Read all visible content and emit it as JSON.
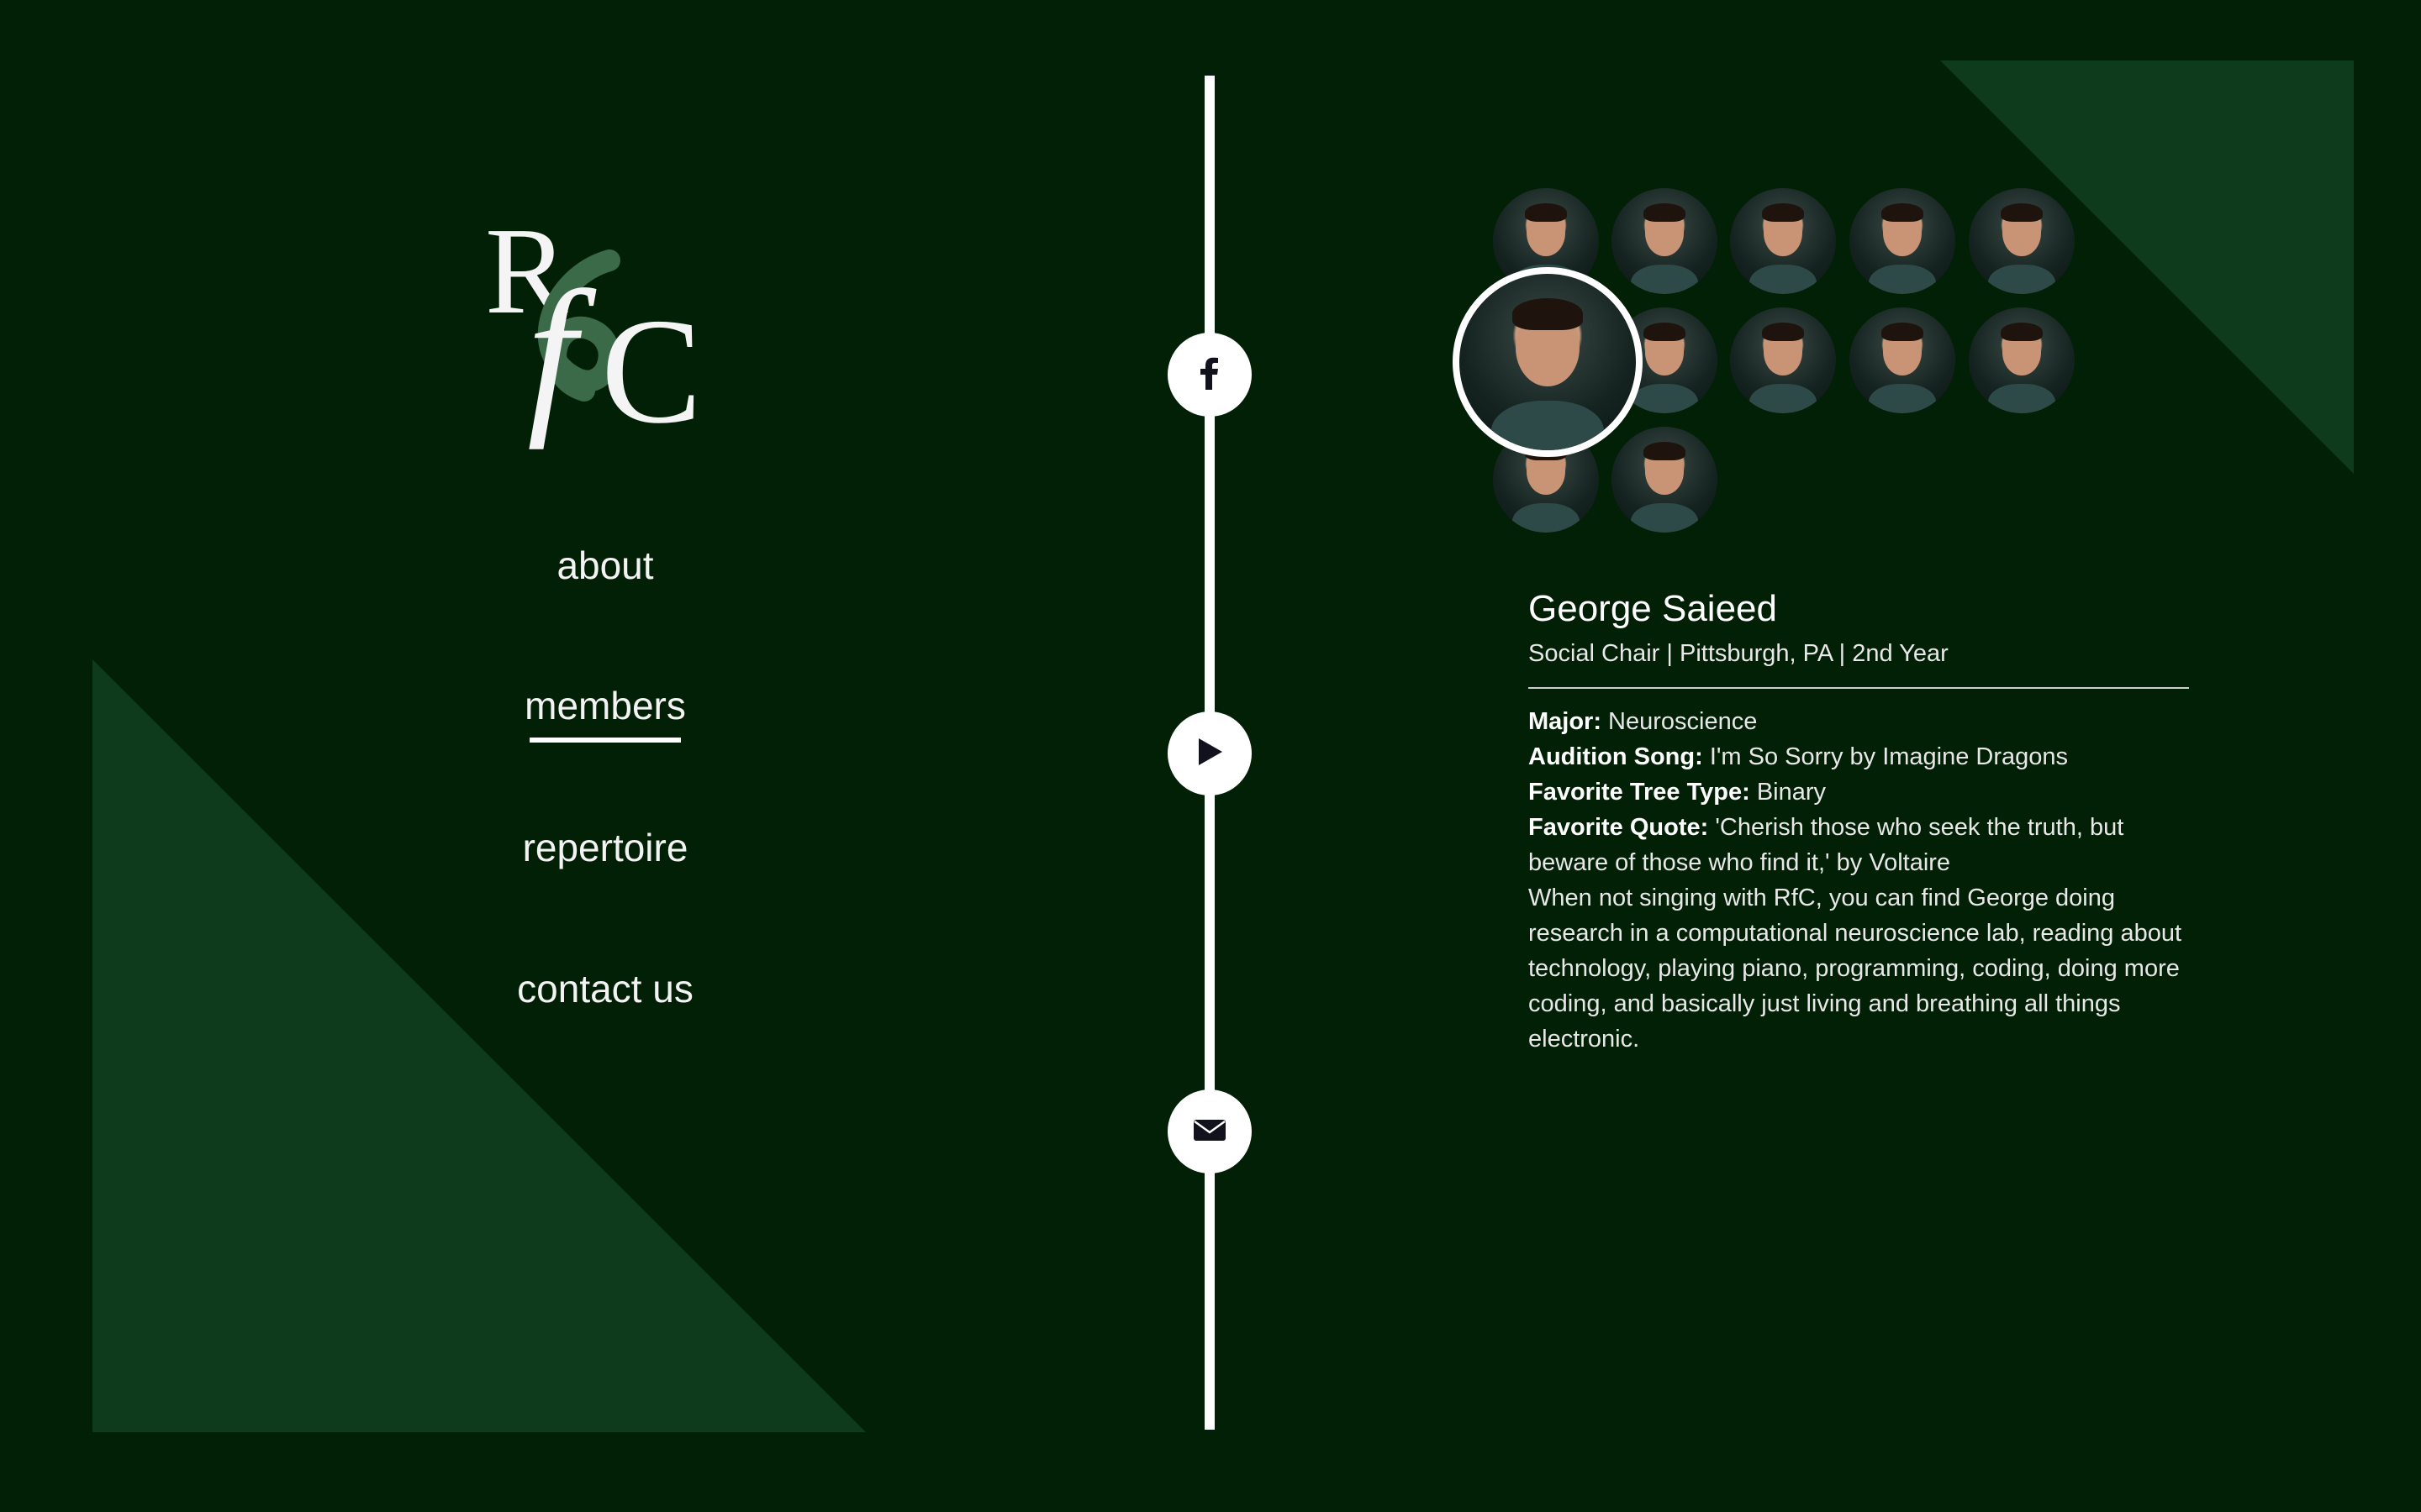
{
  "brand": {
    "logo_letters": "RfC"
  },
  "nav": {
    "items": [
      {
        "label": "about"
      },
      {
        "label": "members",
        "active": true
      },
      {
        "label": "repertoire"
      },
      {
        "label": "contact us"
      }
    ]
  },
  "social": {
    "icons": [
      "facebook-icon",
      "play-icon",
      "mail-icon"
    ]
  },
  "members": {
    "count": 12,
    "selected_index": 5
  },
  "profile": {
    "name": "George Saieed",
    "subtitle": "Social Chair | Pittsburgh, PA | 2nd Year",
    "fields": [
      {
        "label": "Major:",
        "value": " Neuroscience"
      },
      {
        "label": "Audition Song:",
        "value": " I'm So Sorry by Imagine Dragons"
      },
      {
        "label": "Favorite Tree Type:",
        "value": " Binary"
      },
      {
        "label": "Favorite Quote:",
        "value": " 'Cherish those who seek the truth, but beware of those who find it,' by Voltaire"
      }
    ],
    "bio": "When not singing with RfC, you can find George doing research in a computational neuroscience lab, reading about technology, playing piano, programming, coding, doing more coding, and basically just living and breathing all things electronic."
  },
  "colors": {
    "background": "#022006",
    "triangle": "#0d3b1c",
    "accent": "#ffffff"
  }
}
